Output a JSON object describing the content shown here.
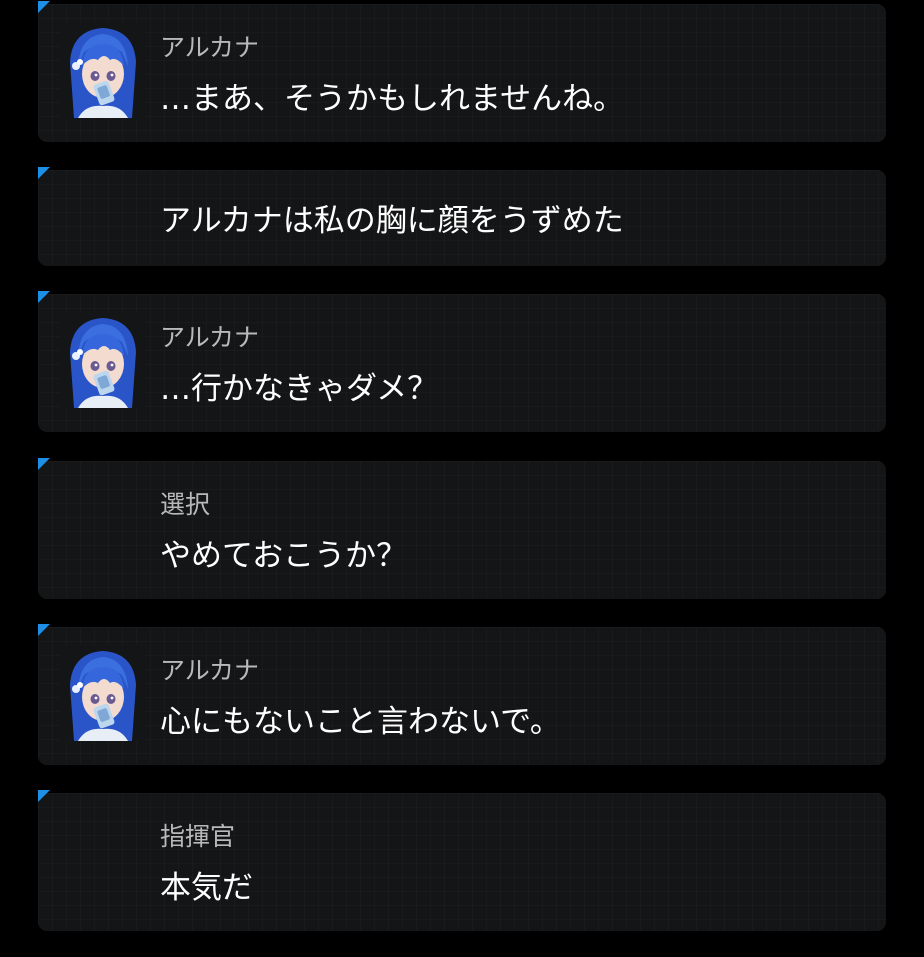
{
  "log": {
    "entries": [
      {
        "type": "dialogue",
        "speaker": "アルカナ",
        "text": "…まあ、そうかもしれませんね。",
        "avatar_icon": "arcana-portrait-icon"
      },
      {
        "type": "narration",
        "speaker": "",
        "text": "アルカナは私の胸に顔をうずめた"
      },
      {
        "type": "dialogue",
        "speaker": "アルカナ",
        "text": "…行かなきゃダメ？",
        "avatar_icon": "arcana-portrait-icon"
      },
      {
        "type": "choice",
        "speaker": "選択",
        "text": "やめておこうか？"
      },
      {
        "type": "dialogue",
        "speaker": "アルカナ",
        "text": "心にもないこと言わないで。",
        "avatar_icon": "arcana-portrait-icon"
      },
      {
        "type": "dialogue",
        "speaker": "指揮官",
        "text": "本気だ"
      }
    ]
  },
  "colors": {
    "background": "#000000",
    "card": "#141516",
    "corner_accent": "#1e8fe6",
    "speaker_text": "#b9b9b9",
    "message_text": "#ffffff",
    "hair": "#2f62d6"
  }
}
